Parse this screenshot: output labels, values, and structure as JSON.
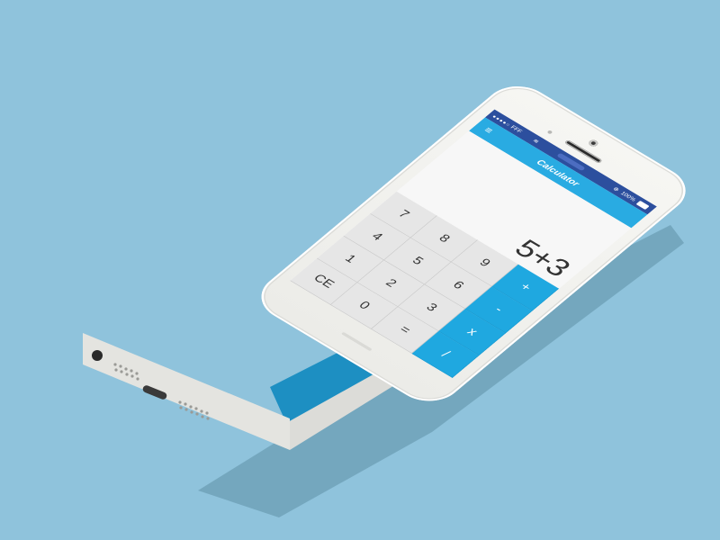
{
  "status_bar": {
    "signal": "●●●●○",
    "carrier": "FFF",
    "wifi": "≋",
    "lock": "⊕",
    "battery": "100%"
  },
  "nav": {
    "menu": "≡",
    "title": "Calculator"
  },
  "display": {
    "expression": "5+3"
  },
  "keypad": {
    "keys": [
      {
        "label": "7",
        "type": "number"
      },
      {
        "label": "8",
        "type": "number"
      },
      {
        "label": "9",
        "type": "number"
      },
      {
        "label": "+",
        "type": "operator"
      },
      {
        "label": "4",
        "type": "number"
      },
      {
        "label": "5",
        "type": "number"
      },
      {
        "label": "6",
        "type": "number"
      },
      {
        "label": "-",
        "type": "operator"
      },
      {
        "label": "1",
        "type": "number"
      },
      {
        "label": "2",
        "type": "number"
      },
      {
        "label": "3",
        "type": "number"
      },
      {
        "label": "x",
        "type": "operator"
      },
      {
        "label": "CE",
        "type": "clear"
      },
      {
        "label": "0",
        "type": "number"
      },
      {
        "label": "=",
        "type": "equals"
      },
      {
        "label": "/",
        "type": "operator"
      }
    ]
  },
  "colors": {
    "background": "#8fc3dc",
    "accent": "#29abe2",
    "accent_dark": "#1d8fc2",
    "status_bar": "#2c4f9e",
    "key_light": "#e6e6e6",
    "phone_body": "#f2f2ef"
  }
}
